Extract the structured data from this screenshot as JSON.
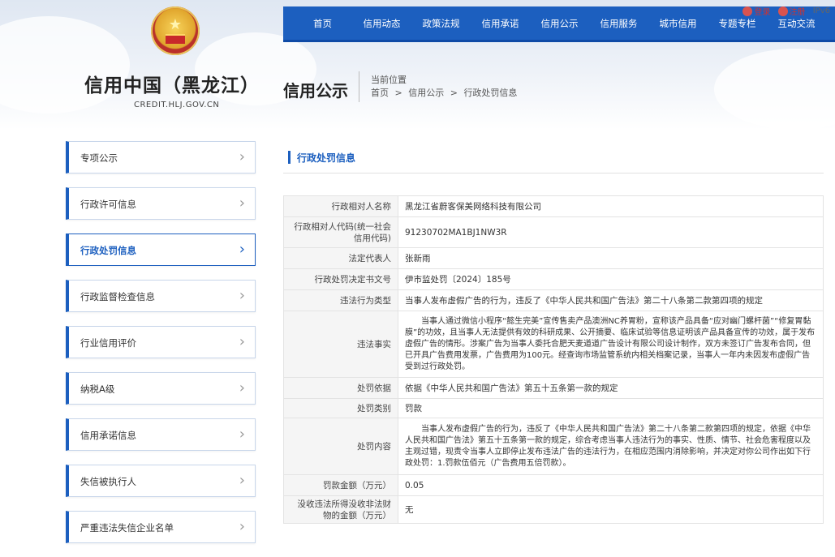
{
  "brand": {
    "title": "信用中国（黑龙江）",
    "subtitle": "CREDIT.HLJ.GOV.CN"
  },
  "section_title": "信用公示",
  "breadcrumb": {
    "label": "当前位置",
    "items": [
      "首页",
      ">",
      "信用公示",
      ">",
      "行政处罚信息"
    ]
  },
  "top_links": {
    "login": "登录",
    "register": "注册",
    "ipv6": "IPv6"
  },
  "nav": [
    "首页",
    "信用动态",
    "政策法规",
    "信用承诺",
    "信用公示",
    "信用服务",
    "城市信用",
    "专题专栏",
    "互动交流"
  ],
  "sidebar": [
    {
      "label": "专项公示"
    },
    {
      "label": "行政许可信息"
    },
    {
      "label": "行政处罚信息"
    },
    {
      "label": "行政监督检查信息"
    },
    {
      "label": "行业信用评价"
    },
    {
      "label": "纳税A级"
    },
    {
      "label": "信用承诺信息"
    },
    {
      "label": "失信被执行人"
    },
    {
      "label": "严重违法失信企业名单"
    }
  ],
  "content_title": "行政处罚信息",
  "rows": [
    {
      "key": "行政相对人名称",
      "value": "黑龙江省蔚客保美网络科技有限公司"
    },
    {
      "key": "行政相对人代码(统一社会信用代码)",
      "value": "91230702MA1BJ1NW3R"
    },
    {
      "key": "法定代表人",
      "value": "张新雨"
    },
    {
      "key": "行政处罚决定书文号",
      "value": "伊市监处罚〔2024〕185号"
    },
    {
      "key": "违法行为类型",
      "value": "当事人发布虚假广告的行为，违反了《中华人民共和国广告法》第二十八条第二款第四项的规定"
    },
    {
      "key": "违法事实",
      "value": "当事人通过微信小程序“懿生完美”宣传售卖产品澳洲NC养胃粉，宣称该产品具备“应对幽门螺杆菌”“修复胃黏膜”的功效，且当事人无法提供有效的科研成果、公开摘要、临床试验等信息证明该产品具备宣传的功效，属于发布虚假广告的情形。涉案广告为当事人委托合肥天麦道道广告设计有限公司设计制作，双方未签订广告发布合同，但已开具广告费用发票，广告费用为100元。经查询市场监管系统内相关档案记录，当事人一年内未因发布虚假广告受到过行政处罚。"
    },
    {
      "key": "处罚依据",
      "value": "依据《中华人民共和国广告法》第五十五条第一款的规定"
    },
    {
      "key": "处罚类别",
      "value": "罚款"
    },
    {
      "key": "处罚内容",
      "value": "当事人发布虚假广告的行为，违反了《中华人民共和国广告法》第二十八条第二款第四项的规定，依据《中华人民共和国广告法》第五十五条第一款的规定，综合考虑当事人违法行为的事实、性质、情节、社会危害程度以及主观过错，现责令当事人立即停止发布违法广告的违法行为，在相应范围内消除影响，并决定对你公司作出如下行政处罚：1.罚款伍佰元（广告费用五倍罚款）。"
    },
    {
      "key": "罚款金额（万元）",
      "value": "0.05"
    },
    {
      "key": "没收违法所得没收非法财物的金额（万元）",
      "value": "无"
    }
  ]
}
